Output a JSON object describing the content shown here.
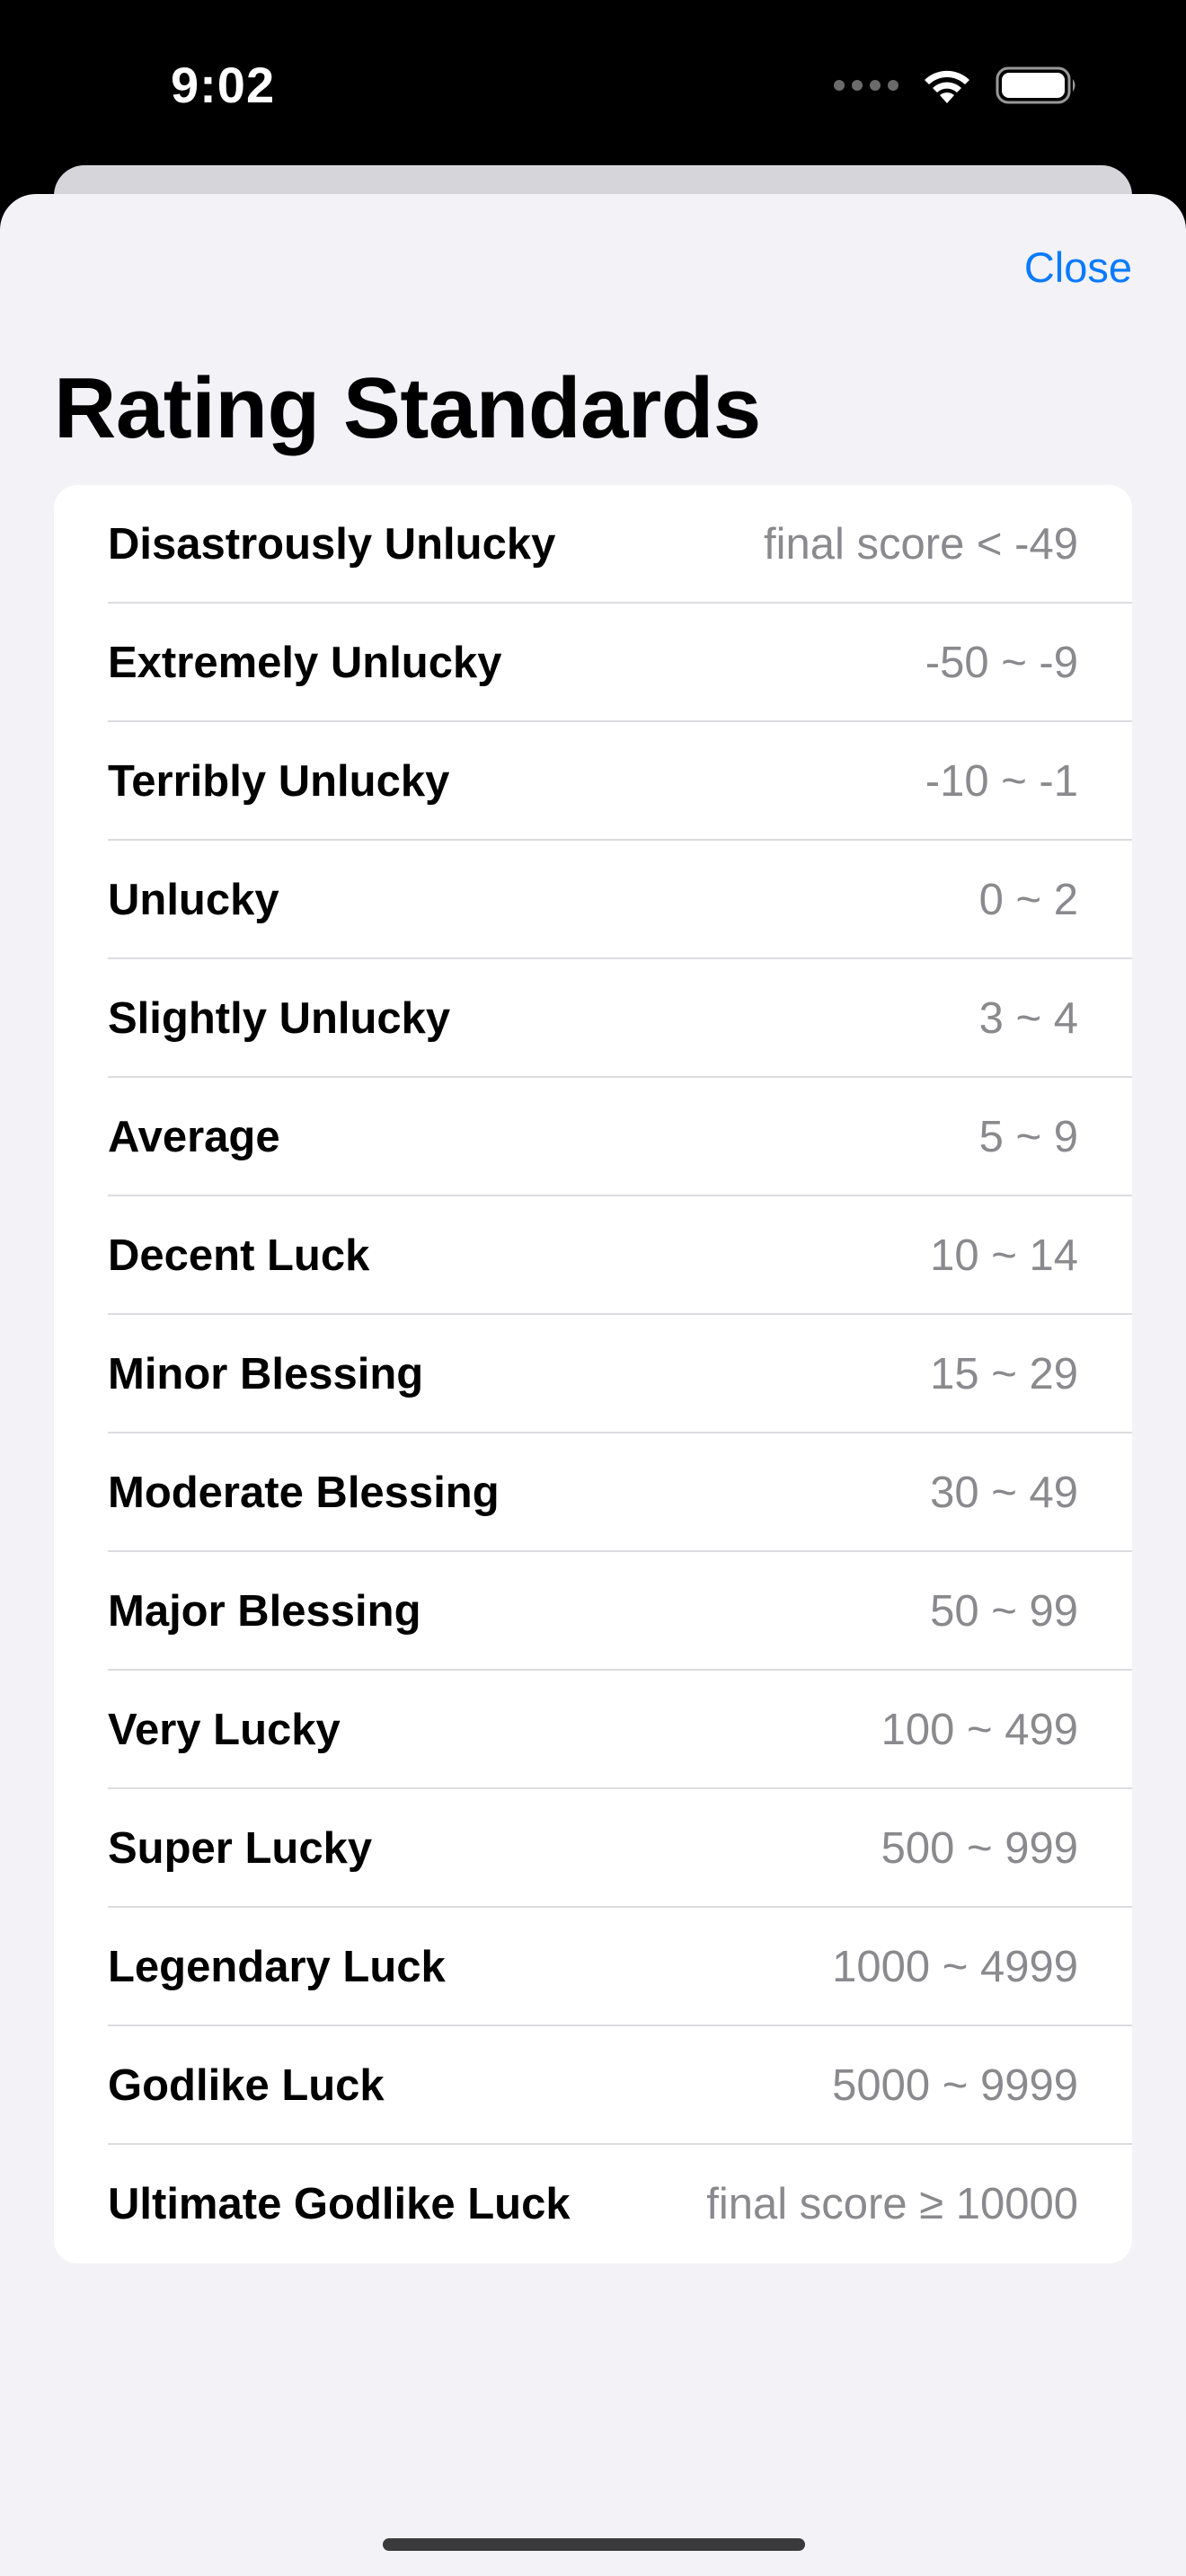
{
  "status_bar": {
    "time": "9:02",
    "icons": [
      "signal-dots-icon",
      "wifi-icon",
      "battery-icon"
    ]
  },
  "header": {
    "close_label": "Close",
    "title": "Rating Standards"
  },
  "colors": {
    "accent": "#0a7aff",
    "background": "#f2f2f7",
    "secondary_text": "#8a8a8e"
  },
  "ratings": [
    {
      "label": "Disastrously Unlucky",
      "range": "final score < -49"
    },
    {
      "label": "Extremely Unlucky",
      "range": "-50 ~ -9"
    },
    {
      "label": "Terribly Unlucky",
      "range": "-10 ~ -1"
    },
    {
      "label": "Unlucky",
      "range": "0 ~ 2"
    },
    {
      "label": "Slightly Unlucky",
      "range": "3 ~ 4"
    },
    {
      "label": "Average",
      "range": "5 ~ 9"
    },
    {
      "label": "Decent Luck",
      "range": "10 ~ 14"
    },
    {
      "label": "Minor Blessing",
      "range": "15 ~ 29"
    },
    {
      "label": "Moderate Blessing",
      "range": "30 ~ 49"
    },
    {
      "label": "Major Blessing",
      "range": "50 ~ 99"
    },
    {
      "label": "Very Lucky",
      "range": "100 ~ 499"
    },
    {
      "label": "Super Lucky",
      "range": "500 ~ 999"
    },
    {
      "label": "Legendary Luck",
      "range": "1000 ~ 4999"
    },
    {
      "label": "Godlike Luck",
      "range": "5000 ~ 9999"
    },
    {
      "label": "Ultimate Godlike Luck",
      "range": "final score ≥ 10000"
    }
  ]
}
